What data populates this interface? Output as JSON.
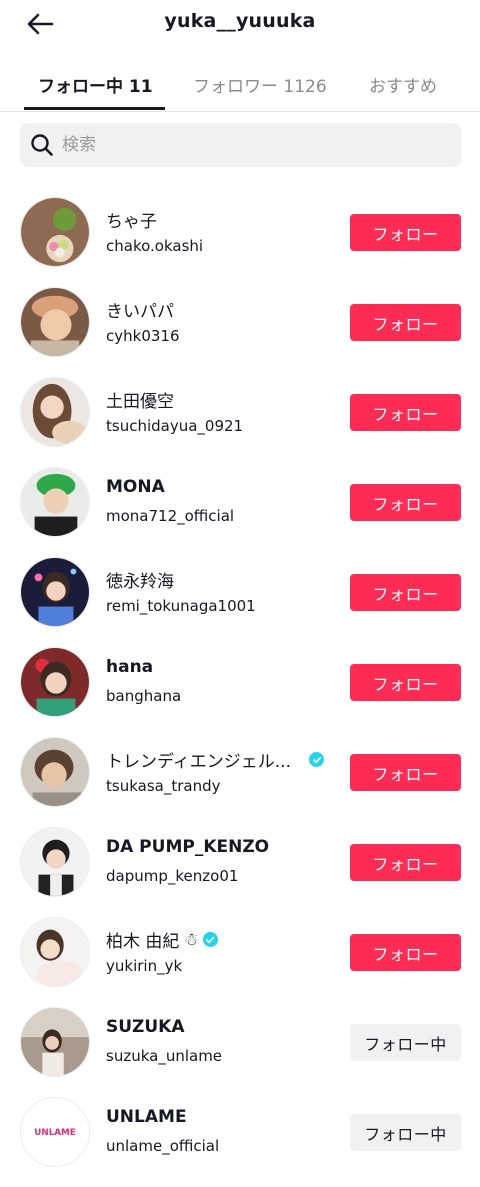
{
  "header": {
    "title": "yuka__yuuuka"
  },
  "tabs": [
    {
      "label": "フォロー中 11"
    },
    {
      "label": "フォロワー 1126"
    },
    {
      "label": "おすすめ"
    }
  ],
  "search": {
    "placeholder": "検索"
  },
  "users": [
    {
      "name": "ちゃ子",
      "handle": "chako.okashi",
      "button": "フォロー",
      "verified": false
    },
    {
      "name": "きいパパ",
      "handle": "cyhk0316",
      "button": "フォロー",
      "verified": false
    },
    {
      "name": "土田優空",
      "handle": "tsuchidayua_0921",
      "button": "フォロー",
      "verified": false
    },
    {
      "name": "MONA",
      "handle": "mona712_official",
      "button": "フォロー",
      "verified": false
    },
    {
      "name": "徳永羚海",
      "handle": "remi_tokunaga1001",
      "button": "フォロー",
      "verified": false
    },
    {
      "name": "hana",
      "handle": "banghana",
      "button": "フォロー",
      "verified": false
    },
    {
      "name": "トレンディエンジェル...",
      "handle": "tsukasa_trandy",
      "button": "フォロー",
      "verified": true
    },
    {
      "name": "DA PUMP_KENZO",
      "handle": "dapump_kenzo01",
      "button": "フォロー",
      "verified": false
    },
    {
      "name": "柏木 由紀",
      "emoji": "☃",
      "handle": "yukirin_yk",
      "button": "フォロー",
      "verified": true
    },
    {
      "name": "SUZUKA",
      "handle": "suzuka_unlame",
      "button": "フォロー中",
      "verified": false
    },
    {
      "name": "UNLAME",
      "handle": "unlame_official",
      "button": "フォロー中",
      "verified": false
    }
  ],
  "avatar_logo": "UNLAME",
  "colors": {
    "accent": "#fe2c55",
    "verified": "#20d5ec",
    "text": "#161823",
    "muted": "#8a8b91"
  }
}
